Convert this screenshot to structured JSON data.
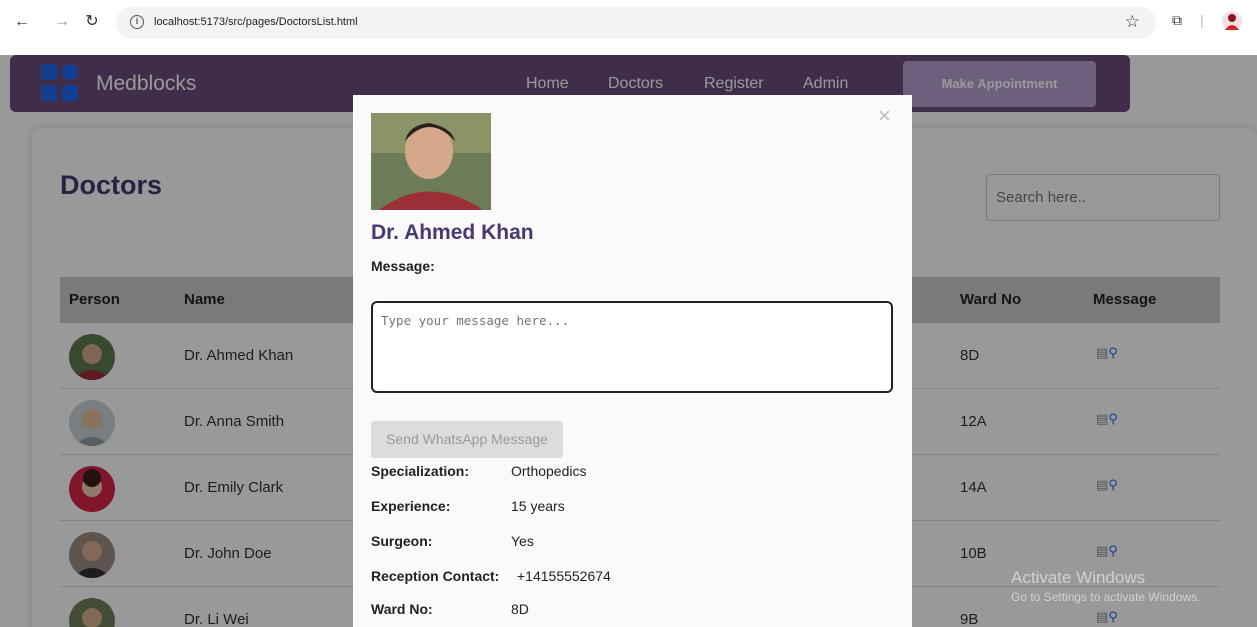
{
  "browser": {
    "url": "localhost:5173/src/pages/DoctorsList.html"
  },
  "nav": {
    "brand": "Medblocks",
    "links": [
      "Home",
      "Doctors",
      "Register",
      "Admin"
    ],
    "appointment_label": "Make Appointment"
  },
  "page": {
    "title": "Doctors",
    "search_placeholder": "Search here.."
  },
  "table": {
    "headers": {
      "person": "Person",
      "name": "Name",
      "ward": "Ward No",
      "message": "Message"
    },
    "rows": [
      {
        "name": "Dr. Ahmed Khan",
        "ward": "8D"
      },
      {
        "name": "Dr. Anna Smith",
        "ward": "12A"
      },
      {
        "name": "Dr. Emily Clark",
        "ward": "14A"
      },
      {
        "name": "Dr. John Doe",
        "ward": "10B"
      },
      {
        "name": "Dr. Li Wei",
        "ward": "9B"
      }
    ]
  },
  "modal": {
    "close_glyph": "×",
    "doctor_name": "Dr. Ahmed Khan",
    "message_label": "Message:",
    "message_placeholder": "Type your message here...",
    "send_label": "Send WhatsApp Message",
    "details": [
      {
        "label": "Specialization:",
        "value": "Orthopedics"
      },
      {
        "label": "Experience:",
        "value": "15 years"
      },
      {
        "label": "Surgeon:",
        "value": "Yes"
      },
      {
        "label": "Reception Contact:",
        "value": "+14155552674"
      },
      {
        "label": "Ward No:",
        "value": "8D"
      }
    ]
  },
  "watermark": {
    "line1": "Activate Windows",
    "line2": "Go to Settings to activate Windows."
  },
  "colors": {
    "nav_bg": "#6a4c7c",
    "accent": "#4b3870",
    "button_bg": "#b6a0cf",
    "logo": "#1e6af0"
  }
}
